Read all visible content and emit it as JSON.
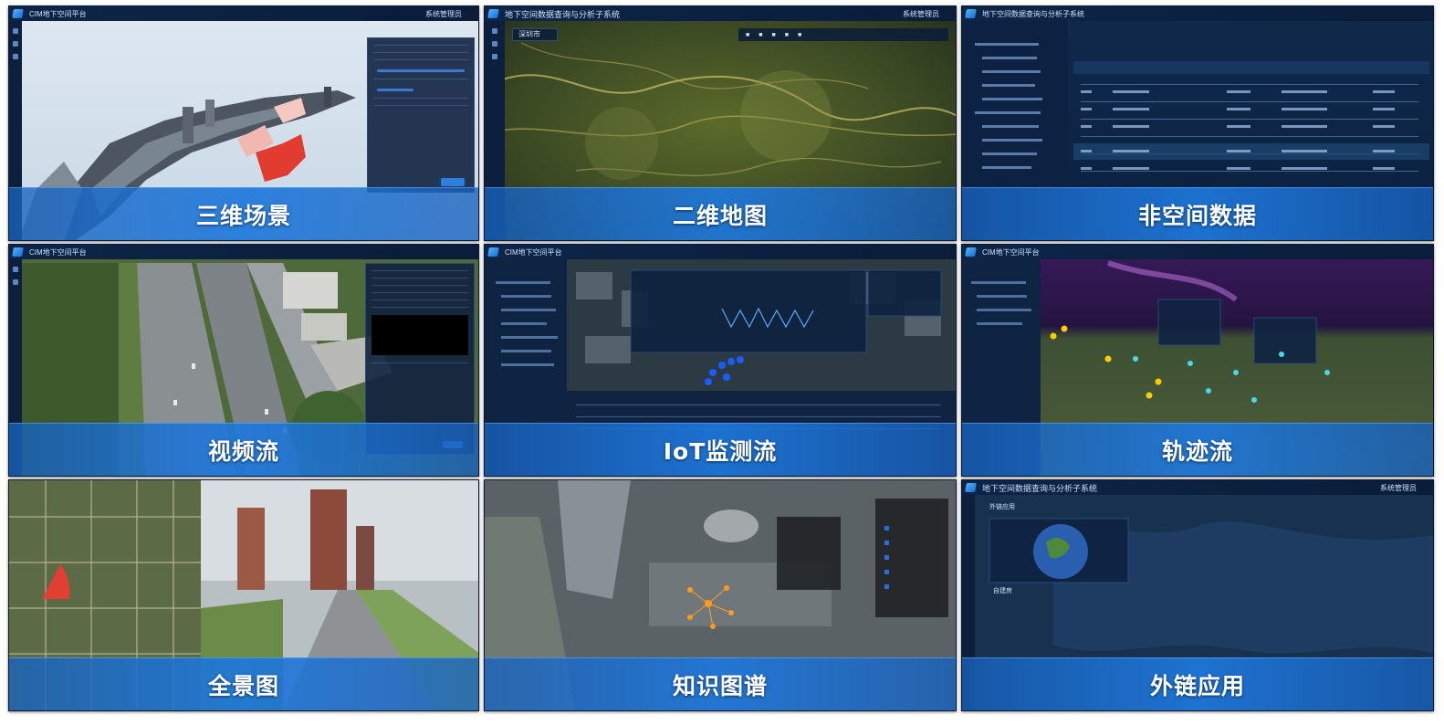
{
  "tiles": [
    {
      "id": "3d-scene",
      "label": "三维场景",
      "app_title": "CIM地下空间平台",
      "user": "系统管理员"
    },
    {
      "id": "2d-map",
      "label": "二维地图",
      "app_title": "地下空间数据查询与分析子系统",
      "user": "系统管理员",
      "search": "深圳市"
    },
    {
      "id": "non-spatial",
      "label": "非空间数据",
      "app_title": "地下空间数据查询与分析子系统"
    },
    {
      "id": "video-stream",
      "label": "视频流",
      "app_title": "CIM地下空间平台"
    },
    {
      "id": "iot-monitor",
      "label": "IoT监测流",
      "app_title": "CIM地下空间平台"
    },
    {
      "id": "trajectory",
      "label": "轨迹流",
      "app_title": "CIM地下空间平台"
    },
    {
      "id": "panorama",
      "label": "全景图"
    },
    {
      "id": "knowledge-graph",
      "label": "知识图谱"
    },
    {
      "id": "external-app",
      "label": "外链应用",
      "app_title": "地下空间数据查询与分析子系统",
      "user": "系统管理员",
      "caption": "自建房",
      "section": "外链应用"
    }
  ],
  "colors": {
    "banner": "#1e78dc",
    "frame": "#0b1b33",
    "accent": "#4fb2ff"
  }
}
